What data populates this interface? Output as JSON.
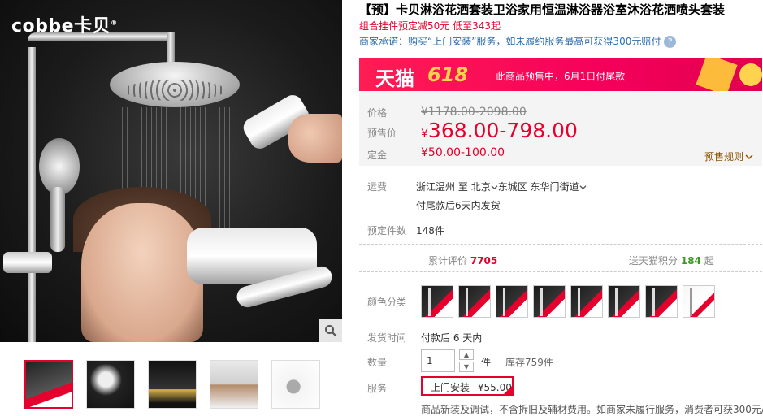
{
  "gallery": {
    "brand_text": "cobbe卡贝",
    "brand_mark": "®",
    "thumbnails": [
      "thumb-1",
      "thumb-2",
      "thumb-3",
      "thumb-4",
      "thumb-5"
    ]
  },
  "product": {
    "title": "【预】卡贝淋浴花洒套装卫浴家用恒温淋浴器浴室沐浴花洒喷头套装",
    "promo": "组合挂件预定减50元 低至343起",
    "promise": "商家承诺：购买“上门安装”服务，如未履约服务最高可获得300元赔付",
    "promise_help": "?"
  },
  "banner": {
    "tmall": "天猫",
    "event": "618",
    "note": "此商品预售中，6月1日付尾款"
  },
  "price": {
    "price_label": "价格",
    "original": "¥1178.00-2098.00",
    "presale_label": "预售价",
    "currency": "¥",
    "presale": "368.00-798.00",
    "deposit_label": "定金",
    "deposit": "¥50.00-100.00",
    "rules_link": "预售规则",
    "rules_icon": "chevron-down"
  },
  "shipping": {
    "label": "运费",
    "from": "浙江温州",
    "to_word": "至",
    "city": "北京",
    "district": "东城区",
    "street": "东华门街道",
    "note": "付尾款后6天内发货"
  },
  "booked": {
    "label": "预定件数",
    "count": "148件"
  },
  "stats": {
    "reviews_label": "累计评价",
    "reviews": "7705",
    "points_prefix": "送天猫积分",
    "points": "184",
    "points_suffix": "起"
  },
  "color": {
    "label": "颜色分类",
    "swatch_count": 8
  },
  "delivery_time": {
    "label": "发货时间",
    "value": "付款后 6 天内"
  },
  "quantity": {
    "label": "数量",
    "value": "1",
    "unit": "件",
    "stock": "库存759件",
    "up": "▲",
    "down": "▼"
  },
  "service": {
    "label": "服务",
    "option": "上门安装",
    "price": "¥55.00"
  },
  "bottom_note": "商品新装及调试，不含拆旧及辅材费用。如商家未履行服务，消费者可获300元/",
  "colors": {
    "accent": "#e5002d",
    "link": "#2b6dad",
    "banner": "#f5005b",
    "points": "#3a9a1f"
  }
}
